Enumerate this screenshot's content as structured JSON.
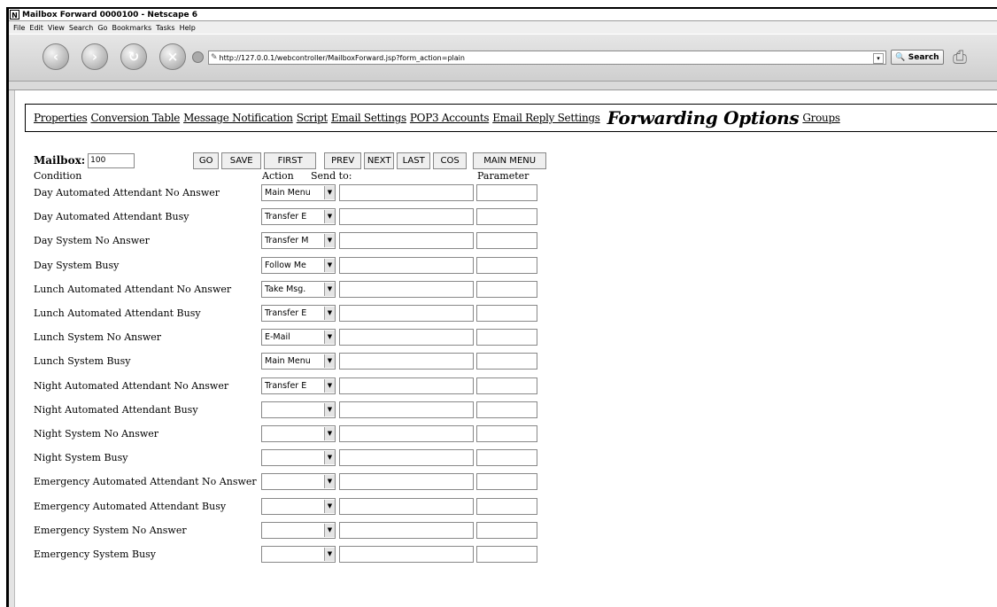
{
  "window": {
    "title": "Mailbox Forward 0000100 - Netscape 6"
  },
  "menu": [
    "File",
    "Edit",
    "View",
    "Search",
    "Go",
    "Bookmarks",
    "Tasks",
    "Help"
  ],
  "toolbar": {
    "url": "http://127.0.0.1/webcontroller/MailboxForward.jsp?form_action=plain",
    "search_label": "Search"
  },
  "nav_links": [
    "Properties",
    "Conversion Table",
    "Message Notification",
    "Script",
    "Email Settings",
    "POP3 Accounts",
    "Email Reply Settings"
  ],
  "nav_active": "Forwarding Options",
  "nav_links_after": [
    "Groups"
  ],
  "mailbox": {
    "label": "Mailbox:",
    "value": "100"
  },
  "buttons": {
    "go": "GO",
    "save": "SAVE",
    "first": "FIRST",
    "prev": "PREV",
    "next": "NEXT",
    "last": "LAST",
    "cos": "COS",
    "main_menu": "MAIN MENU"
  },
  "headers": {
    "condition": "Condition",
    "action": "Action",
    "send_to": "Send to:",
    "parameter": "Parameter"
  },
  "rows": [
    {
      "condition": "Day Automated Attendant  No Answer",
      "action": "Main Menu"
    },
    {
      "condition": "Day Automated Attendant  Busy",
      "action": "Transfer E"
    },
    {
      "condition": "Day System  No Answer",
      "action": "Transfer M"
    },
    {
      "condition": "Day System Busy",
      "action": "Follow Me"
    },
    {
      "condition": "Lunch Automated Attendant  No Answer",
      "action": "Take Msg."
    },
    {
      "condition": "Lunch Automated Attendant  Busy",
      "action": "Transfer E"
    },
    {
      "condition": "Lunch System  No Answer",
      "action": "E-Mail"
    },
    {
      "condition": "Lunch System Busy",
      "action": "Main Menu"
    },
    {
      "condition": "Night Automated Attendant  No Answer",
      "action": "Transfer E"
    },
    {
      "condition": "Night Automated Attendant  Busy",
      "action": ""
    },
    {
      "condition": "Night System  No Answer",
      "action": ""
    },
    {
      "condition": "Night System Busy",
      "action": ""
    },
    {
      "condition": "Emergency Automated Attendant  No Answer",
      "action": ""
    },
    {
      "condition": "Emergency Automated Attendant  Busy",
      "action": ""
    },
    {
      "condition": "Emergency System  No Answer",
      "action": ""
    },
    {
      "condition": "Emergency System Busy",
      "action": ""
    }
  ]
}
